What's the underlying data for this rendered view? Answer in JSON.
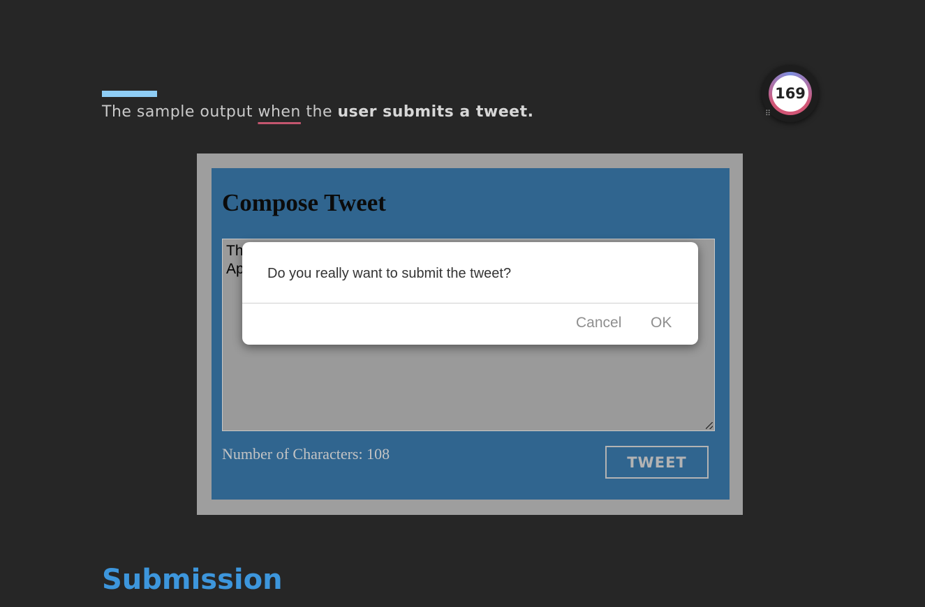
{
  "intro": {
    "part1": "The sample output ",
    "underlined": "when",
    "part2": " the ",
    "bold": "user submits a tweet."
  },
  "badge": {
    "count": "169"
  },
  "compose": {
    "title": "Compose Tweet",
    "textarea_visible_line1": "Th",
    "textarea_visible_line2": "Ap",
    "char_count": "Number of Characters: 108",
    "tweet_button": "TWEET"
  },
  "dialog": {
    "message": "Do you really want to submit the tweet?",
    "cancel_label": "Cancel",
    "ok_label": "OK"
  },
  "section": {
    "heading": "Submission"
  },
  "colors": {
    "background": "#262626",
    "accent_bar": "#8ecdf5",
    "compose_bg": "#30658f",
    "heading_blue": "#3d96dc",
    "underline": "#c4566f"
  }
}
